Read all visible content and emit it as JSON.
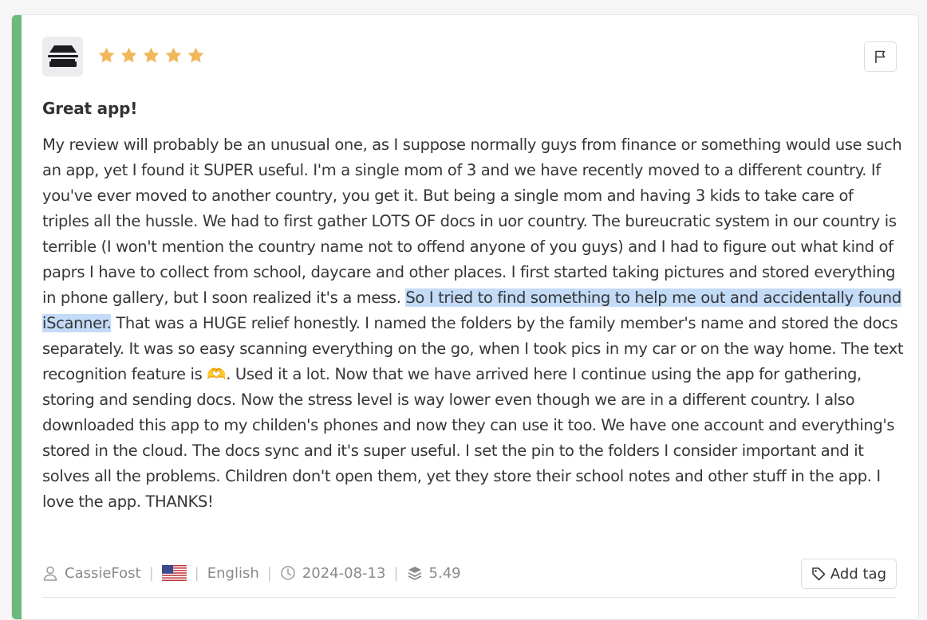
{
  "review": {
    "rating": 5,
    "title": "Great app!",
    "body_before": "My review will probably be an unusual one, as I suppose normally guys from finance or something would use such an app, yet I found it SUPER useful. I'm a single mom of 3 and we have recently moved to a different country. If you've ever moved to another country, you get it. But being a single mom and having 3 kids to take care of triples all the hussle. We had to first gather LOTS OF docs in uor country. The bureucratic system in our country is terrible (I won't mention the country name not to offend anyone of you guys) and I had to figure out what kind of paprs I have to collect from school, daycare and other places. I first started taking pictures and stored everything in phone gallery, but I soon realized it's a mess. ",
    "body_highlight": "So I tried to find something to help me out and accidentally found iScanner.",
    "body_after": " That was a HUGE relief honestly. I named the folders by the family member's name and stored the docs separately. It was so easy scanning everything on the go, when I took pics in my car or on the way home. The text recognition feature is 🫶. Used it a lot. Now that we have arrived here I continue using the app for gathering, storing and sending docs. Now the stress level is way lower even though we are in a different country. I also downloaded this app to my childen's phones and now they can use it too. We have one account and everything's stored in the cloud. The docs sync and it's super useful. I set the pin to the folders I consider important and it solves all the problems. Children don't open them, yet they store their school notes and other stuff in the app. I love the app. THANKS!"
  },
  "meta": {
    "author": "CassieFost",
    "separator": "|",
    "language": "English",
    "date": "2024-08-13",
    "version": "5.49"
  },
  "actions": {
    "add_tag_label": "Add tag"
  },
  "icons": {
    "app": "scanner-app-icon",
    "flag_report": "flag-icon",
    "user": "user-icon",
    "country": "us-flag-icon",
    "date": "clock-icon",
    "version": "layers-icon",
    "tag": "tag-icon"
  },
  "colors": {
    "accent": "#6db87b",
    "star": "#f0b85a",
    "highlight": "#c3dbf7"
  }
}
